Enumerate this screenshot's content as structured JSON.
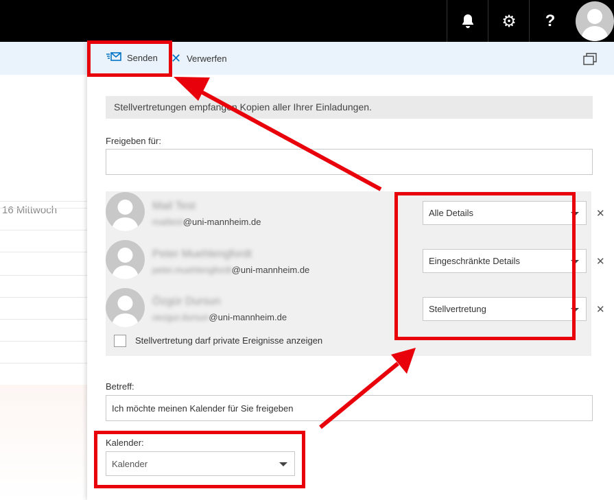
{
  "topbar": {
    "icons": [
      "bell-icon",
      "gear-icon",
      "help-icon",
      "avatar"
    ],
    "help_label": "?"
  },
  "background": {
    "date_text": "16 Mittwoch"
  },
  "toolbar": {
    "send_label": "Senden",
    "discard_label": "Verwerfen"
  },
  "info_text": "Stellvertretungen empfangen Kopien aller Ihrer Einladungen.",
  "share_with_label": "Freigeben für:",
  "share_with_value": "",
  "people": [
    {
      "name": "Mail Test",
      "email_user": "mailtest",
      "email_domain": "@uni-mannheim.de",
      "permission": "Alle Details"
    },
    {
      "name": "Peter Muehlengfordt",
      "email_user": "peter.muehlengfordt",
      "email_domain": "@uni-mannheim.de",
      "permission": "Eingeschränkte Details"
    },
    {
      "name": "Özgür Dursun",
      "email_user": "oezgur.dursun",
      "email_domain": "@uni-mannheim.de",
      "permission": "Stellvertretung"
    }
  ],
  "delegate_private_label": "Stellvertretung darf private Ereignisse anzeigen",
  "subject_label": "Betreff:",
  "subject_value": "Ich möchte meinen Kalender für Sie freigeben",
  "calendar_label": "Kalender:",
  "calendar_value": "Kalender",
  "colors": {
    "highlight": "#e8000b",
    "accent": "#0072c6",
    "topbar": "#000000"
  }
}
